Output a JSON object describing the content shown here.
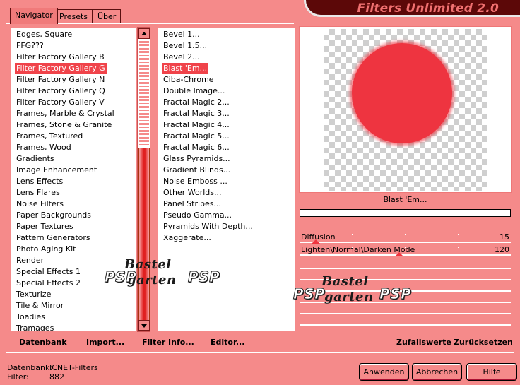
{
  "tabs": [
    {
      "label": "Navigator",
      "active": true
    },
    {
      "label": "Presets",
      "active": false
    },
    {
      "label": "Über",
      "active": false
    }
  ],
  "title": "Filters Unlimited 2.0",
  "categories": {
    "items": [
      "Edges, Square",
      "FFG???",
      "Filter Factory Gallery B",
      "Filter Factory Gallery G",
      "Filter Factory Gallery N",
      "Filter Factory Gallery Q",
      "Filter Factory Gallery V",
      "Frames, Marble & Crystal",
      "Frames, Stone & Granite",
      "Frames, Textured",
      "Frames, Wood",
      "Gradients",
      "Image Enhancement",
      "Lens Effects",
      "Lens Flares",
      "Noise Filters",
      "Paper Backgrounds",
      "Paper Textures",
      "Pattern Generators",
      "Photo Aging Kit",
      "Render",
      "Special Effects 1",
      "Special Effects 2",
      "Texturize",
      "Tile & Mirror",
      "Toadies",
      "Tramages"
    ],
    "selected": "Filter Factory Gallery G"
  },
  "filters": {
    "items": [
      "Bevel 1...",
      "Bevel 1.5...",
      "Bevel 2...",
      "Blast 'Em...",
      "Ciba-Chrome",
      "Double Image...",
      "Fractal Magic 2...",
      "Fractal Magic 3...",
      "Fractal Magic 4...",
      "Fractal Magic 5...",
      "Fractal Magic 6...",
      "Glass Pyramids...",
      "Gradient Blinds...",
      "Noise Emboss ...",
      "Other Worlds...",
      "Panel Stripes...",
      "Pseudo Gamma...",
      "Pyramids With Depth...",
      "Xaggerate..."
    ],
    "selected": "Blast 'Em..."
  },
  "preview": {
    "filter_name": "Blast 'Em...",
    "blob_color": "#ee3440"
  },
  "sliders": [
    {
      "label": "Diffusion",
      "value": "15",
      "level": 0.06
    },
    {
      "label": "Lighten\\Normal\\Darken Mode",
      "value": "120",
      "level": 0.47
    }
  ],
  "toolbar_left": {
    "database": "Datenbank",
    "import": "Import...",
    "filter_info": "Filter Info...",
    "editor": "Editor..."
  },
  "toolbar_right": {
    "random": "Zufallswerte",
    "reset": "Zurücksetzen"
  },
  "status": {
    "database_label": "Datenbank:",
    "database_value": "ICNET-Filters",
    "filter_label": "Filter:",
    "filter_value": "882"
  },
  "buttons": {
    "apply": "Anwenden",
    "cancel": "Abbrechen",
    "help": "Hilfe"
  },
  "watermark": {
    "line1": "Bastel",
    "line2": "garten",
    "badge": "PSP"
  },
  "colors": {
    "background": "#f58a8a",
    "selection": "#f0434a",
    "banner": "#5c0808"
  }
}
